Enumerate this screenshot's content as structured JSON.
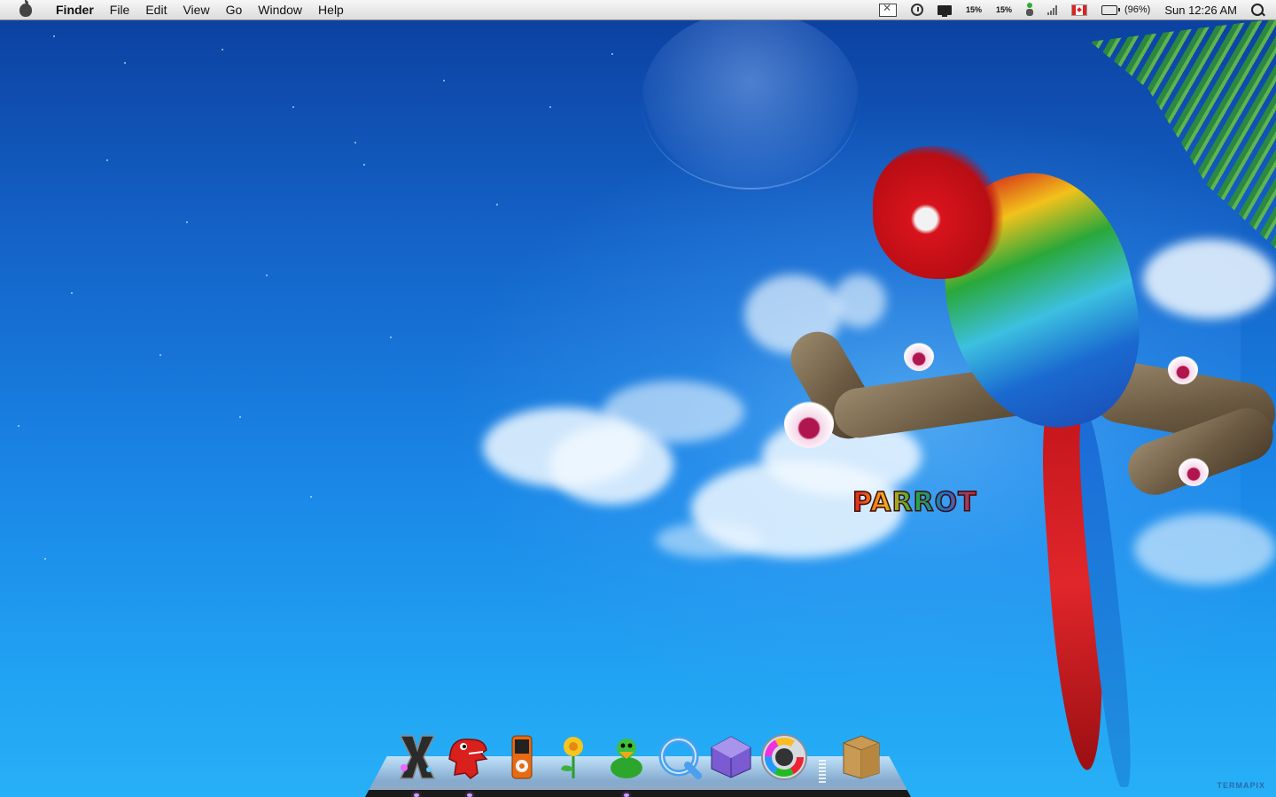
{
  "menubar": {
    "app_name": "Finder",
    "menus": [
      "File",
      "Edit",
      "View",
      "Go",
      "Window",
      "Help"
    ],
    "status": {
      "cpu1": "15%",
      "cpu2": "15%",
      "battery_percent": "(96%)",
      "clock": "Sun 12:26 AM"
    },
    "status_icons": [
      "mail-icon",
      "time-machine-icon",
      "display-icon",
      "user-status-icon",
      "wifi-signal-icon",
      "canada-flag-icon",
      "battery-icon",
      "spotlight-icon"
    ]
  },
  "wallpaper": {
    "title_text": "PARROT",
    "watermark": "TERMAPIX"
  },
  "dock": {
    "items": [
      {
        "name": "x-app-icon",
        "running": true
      },
      {
        "name": "red-dinosaur-icon",
        "running": true
      },
      {
        "name": "ipod-icon",
        "running": false
      },
      {
        "name": "flower-icon",
        "running": false
      },
      {
        "name": "green-duck-icon",
        "running": true
      },
      {
        "name": "quicktime-icon",
        "running": false
      },
      {
        "name": "purple-cube-icon",
        "running": false
      },
      {
        "name": "color-wheel-icon",
        "running": false
      },
      {
        "name": "box-icon",
        "running": false
      }
    ]
  },
  "colors": {
    "sky_top": "#0b3f9e",
    "sky_bottom": "#27b0f6",
    "menubar": "#e8e8e8"
  }
}
